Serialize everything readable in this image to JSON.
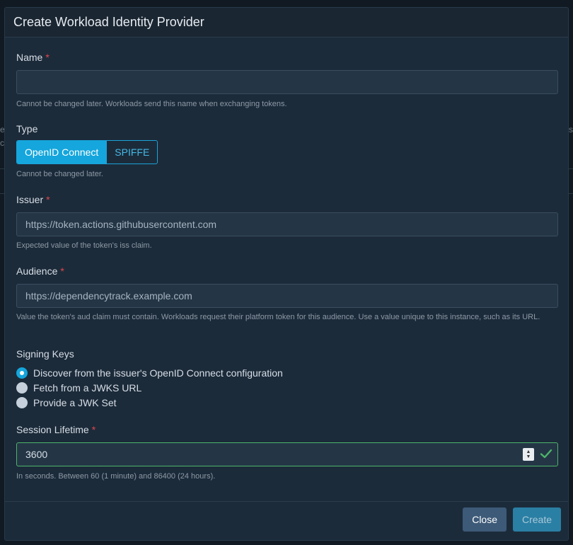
{
  "dialog": {
    "title": "Create Workload Identity Provider"
  },
  "name_field": {
    "label": "Name",
    "required_mark": "*",
    "value": "",
    "help": "Cannot be changed later. Workloads send this name when exchanging tokens."
  },
  "type_field": {
    "label": "Type",
    "options": [
      "OpenID Connect",
      "SPIFFE"
    ],
    "selected": "OpenID Connect",
    "help": "Cannot be changed later."
  },
  "issuer_field": {
    "label": "Issuer",
    "required_mark": "*",
    "placeholder": "https://token.actions.githubusercontent.com",
    "help": "Expected value of the token's iss claim."
  },
  "audience_field": {
    "label": "Audience",
    "required_mark": "*",
    "placeholder": "https://dependencytrack.example.com",
    "help": "Value the token's aud claim must contain. Workloads request their platform token for this audience. Use a value unique to this instance, such as its URL."
  },
  "signing_keys": {
    "label": "Signing Keys",
    "options": [
      "Discover from the issuer's OpenID Connect configuration",
      "Fetch from a JWKS URL",
      "Provide a JWK Set"
    ],
    "selected_index": 0
  },
  "session_lifetime": {
    "label": "Session Lifetime",
    "required_mark": "*",
    "value": "3600",
    "help": "In seconds. Between 60 (1 minute) and 86400 (24 hours)."
  },
  "footer": {
    "close_label": "Close",
    "create_label": "Create"
  },
  "colors": {
    "accent": "#14a6dc",
    "required": "#e0464c",
    "valid": "#4db46a",
    "close_button": "#3d5a78",
    "create_button": "#2a7fa4"
  }
}
